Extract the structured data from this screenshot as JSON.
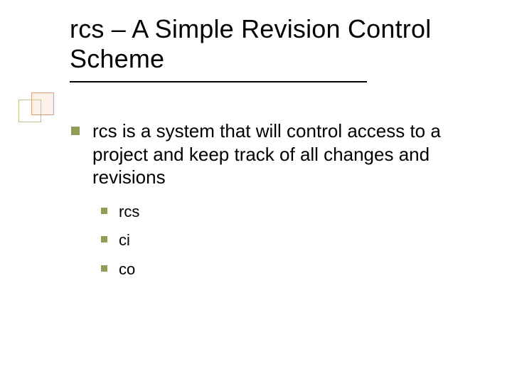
{
  "title": "rcs – A Simple Revision Control Scheme",
  "body": {
    "point1": {
      "text": "rcs is a system that will control access to a project and keep track of all changes and revisions",
      "sub": [
        {
          "text": "rcs"
        },
        {
          "text": "ci"
        },
        {
          "text": "co"
        }
      ]
    }
  }
}
